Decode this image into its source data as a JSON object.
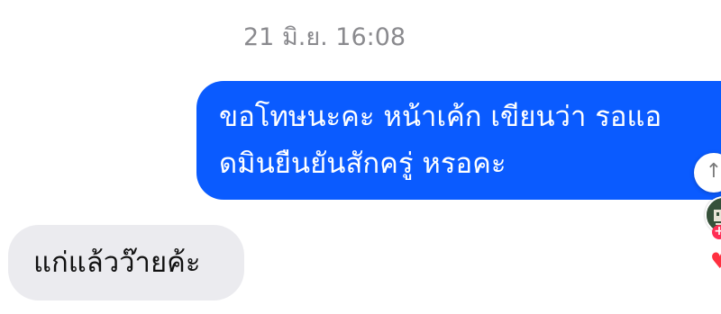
{
  "chat": {
    "timestamp": "21 มิ.ย. 16:08",
    "outgoing": {
      "line1": "ขอโทษนะคะ หน้าเค้ก เขียนว่า รอแอ",
      "line2": "ดมินยืนยันสักครู่ หรอคะ"
    },
    "incoming": {
      "text": "แก่แล้วว๊ายค้ะ"
    }
  },
  "icons": {
    "scroll": "arrow-up-icon",
    "avatar": "shop-avatar",
    "badge": "plus-icon",
    "heart": "heart-icon"
  },
  "colors": {
    "outgoing_bubble": "#0a5bff",
    "incoming_bubble": "#ebebef",
    "timestamp": "#8a8a8e",
    "heart": "#ff3040"
  }
}
